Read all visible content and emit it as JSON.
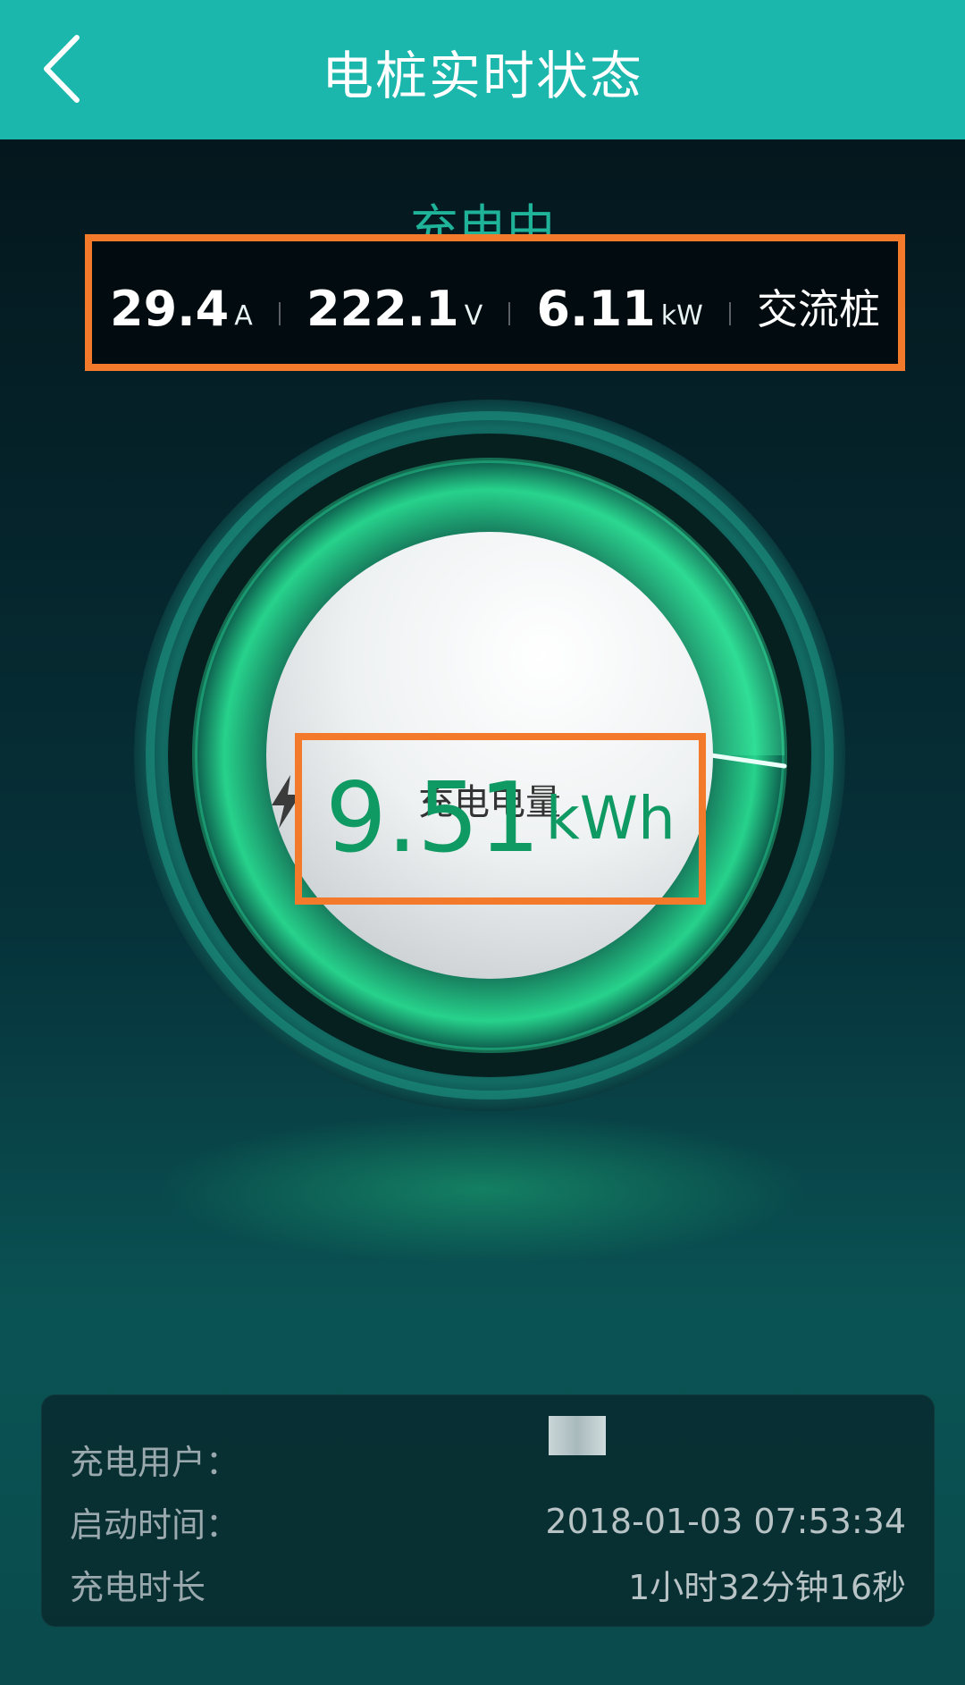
{
  "header": {
    "title": "电桩实时状态",
    "back_icon": "chevron-left-icon"
  },
  "status": {
    "label": "充电中"
  },
  "stats": {
    "current": {
      "value": "29.4",
      "unit": "A"
    },
    "voltage": {
      "value": "222.1",
      "unit": "V"
    },
    "power": {
      "value": "6.11",
      "unit": "kW"
    },
    "pile_type": "交流桩"
  },
  "gauge": {
    "icon": "lightning-icon",
    "label": "充电电量",
    "value": "9.51",
    "unit": "kWh"
  },
  "info": {
    "user_label": "充电用户：",
    "user_value": "",
    "start_label": "启动时间：",
    "start_value": "2018-01-03 07:53:34",
    "duration_label": "充电时长",
    "duration_value": "1小时32分钟16秒"
  },
  "colors": {
    "header_bg": "#1bb7ac",
    "accent_green": "#0f9a63",
    "highlight_border": "#f47a2b"
  }
}
